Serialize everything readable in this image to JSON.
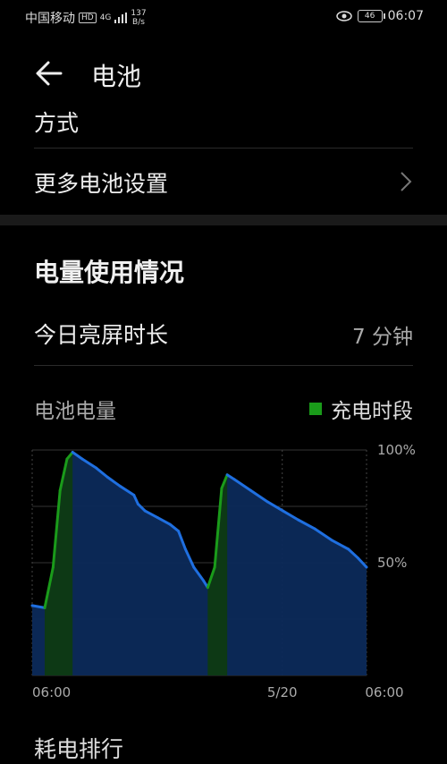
{
  "status": {
    "carrier": "中国移动",
    "hd": "HD",
    "network": "4G",
    "speed_value": "137",
    "speed_unit": "B/s",
    "battery": "46",
    "time": "06:07"
  },
  "appbar": {
    "title": "电池"
  },
  "settings": {
    "partial_row_label": "方式",
    "more_settings_label": "更多电池设置"
  },
  "usage": {
    "section_title": "电量使用情况",
    "screen_time_label": "今日亮屏时长",
    "screen_time_value": "7 分钟",
    "chart_title": "电池电量",
    "legend_label": "充电时段"
  },
  "bottom_partial": "耗电排行",
  "colors": {
    "charging": "#1a9b1a",
    "discharge_line": "#1f6fe0",
    "fill": "#0c2a5a"
  },
  "chart_data": {
    "type": "area",
    "title": "电池电量",
    "x_tick_labels": [
      "06:00",
      "5/20",
      "06:00"
    ],
    "y_tick_labels": [
      "100%",
      "50%"
    ],
    "ylim": [
      0,
      100
    ],
    "x_unit": "hours since 06:00 (5/19)",
    "xlim": [
      0,
      24
    ],
    "legend": [
      "充电时段"
    ],
    "series": [
      {
        "name": "电池电量",
        "points": [
          [
            0,
            31
          ],
          [
            0.9,
            30
          ],
          [
            1.5,
            48
          ],
          [
            2.0,
            82
          ],
          [
            2.5,
            96
          ],
          [
            2.9,
            99
          ],
          [
            3.6,
            96
          ],
          [
            4.6,
            92
          ],
          [
            5.4,
            88
          ],
          [
            6.3,
            84
          ],
          [
            7.3,
            80
          ],
          [
            7.6,
            76
          ],
          [
            8.1,
            73
          ],
          [
            9.0,
            70
          ],
          [
            9.9,
            67
          ],
          [
            10.5,
            64
          ],
          [
            11.0,
            56
          ],
          [
            11.6,
            48
          ],
          [
            12.3,
            42
          ],
          [
            12.6,
            39
          ],
          [
            13.1,
            48
          ],
          [
            13.6,
            83
          ],
          [
            14.0,
            89
          ],
          [
            14.5,
            87
          ],
          [
            15.7,
            82
          ],
          [
            16.9,
            77
          ],
          [
            18.0,
            73
          ],
          [
            19.1,
            69
          ],
          [
            20.3,
            65
          ],
          [
            21.5,
            60
          ],
          [
            22.7,
            56
          ],
          [
            23.4,
            52
          ],
          [
            24.0,
            48
          ]
        ]
      }
    ],
    "charging_periods": [
      [
        0.9,
        2.9
      ],
      [
        12.6,
        14.0
      ]
    ],
    "grid": true,
    "legend_position": "top-right"
  }
}
